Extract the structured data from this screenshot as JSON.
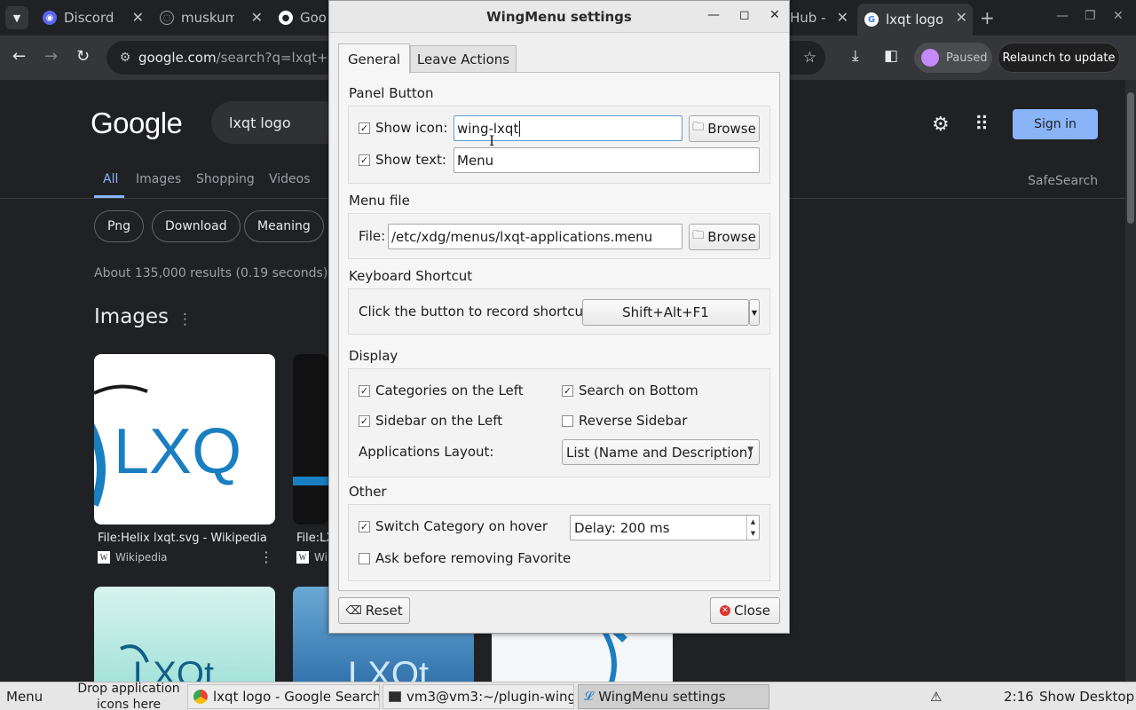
{
  "browser": {
    "tabs": [
      {
        "label": "Discord",
        "icon": "discord-icon",
        "color": "#5865f2"
      },
      {
        "label": "muskum",
        "icon": "globe-icon",
        "color": "#9aa0a6"
      },
      {
        "label": "Goo",
        "icon": "github-icon",
        "color": "#ffffff"
      },
      {
        "label": "Hub -",
        "icon": "github-icon",
        "color": "#ffffff"
      },
      {
        "label": "lxqt logo",
        "icon": "google-icon",
        "color": "#ffffff",
        "active": true
      }
    ],
    "url_host": "google.com",
    "url_path": "/search?q=lxqt+logo",
    "paused_label": "Paused",
    "relaunch_label": "Relaunch to update"
  },
  "google": {
    "logo": "Google",
    "query": "lxqt logo",
    "sign_in": "Sign in",
    "tabs": [
      "All",
      "Images",
      "Shopping",
      "Videos"
    ],
    "safesearch": "SafeSearch",
    "chips": [
      "Png",
      "Download",
      "Meaning"
    ],
    "result_stats": "About 135,000 results (0.19 seconds)",
    "images_heading": "Images",
    "image_results": [
      {
        "caption": "File:Helix lxqt.svg - Wikipedia",
        "source": "Wikipedia",
        "art": "LXQ"
      },
      {
        "caption": "File:LX",
        "source": "Wi",
        "art": ""
      }
    ],
    "image_row2_text": "LXQt"
  },
  "dialog": {
    "title": "WingMenu settings",
    "tabs": [
      "General",
      "Leave Actions"
    ],
    "panel_button": {
      "title": "Panel Button",
      "show_icon_label": "Show icon:",
      "show_icon_checked": true,
      "icon_value": "wing-lxqt",
      "browse_label": "Browse",
      "show_text_label": "Show text:",
      "show_text_checked": true,
      "text_value": "Menu"
    },
    "menu_file": {
      "title": "Menu file",
      "file_label": "File:",
      "file_value": "/etc/xdg/menus/lxqt-applications.menu",
      "browse_label": "Browse"
    },
    "shortcut": {
      "title": "Keyboard Shortcut",
      "label": "Click the button to record shortcut:",
      "value": "Shift+Alt+F1"
    },
    "display": {
      "title": "Display",
      "categories_left": "Categories on the Left",
      "categories_left_checked": true,
      "search_bottom": "Search on Bottom",
      "search_bottom_checked": true,
      "sidebar_left": "Sidebar on the Left",
      "sidebar_left_checked": true,
      "reverse_sidebar": "Reverse Sidebar",
      "reverse_sidebar_checked": false,
      "layout_label": "Applications Layout:",
      "layout_value": "List (Name and Description)"
    },
    "other": {
      "title": "Other",
      "switch_hover": "Switch Category on hover",
      "switch_hover_checked": true,
      "delay_value": "Delay: 200 ms",
      "ask_remove": "Ask before removing Favorite",
      "ask_remove_checked": false
    },
    "reset_label": "Reset",
    "close_label": "Close"
  },
  "taskbar": {
    "menu_label": "Menu",
    "drop_hint": "Drop application icons here",
    "tasks": [
      {
        "label": "lxqt logo - Google Search...",
        "icon": "chrome-icon"
      },
      {
        "label": "vm3@vm3:~/plugin-wing...",
        "icon": "terminal-icon"
      },
      {
        "label": "WingMenu settings",
        "icon": "wing-icon",
        "active": true
      }
    ],
    "clock": "2:16",
    "show_desktop": "Show Desktop"
  }
}
